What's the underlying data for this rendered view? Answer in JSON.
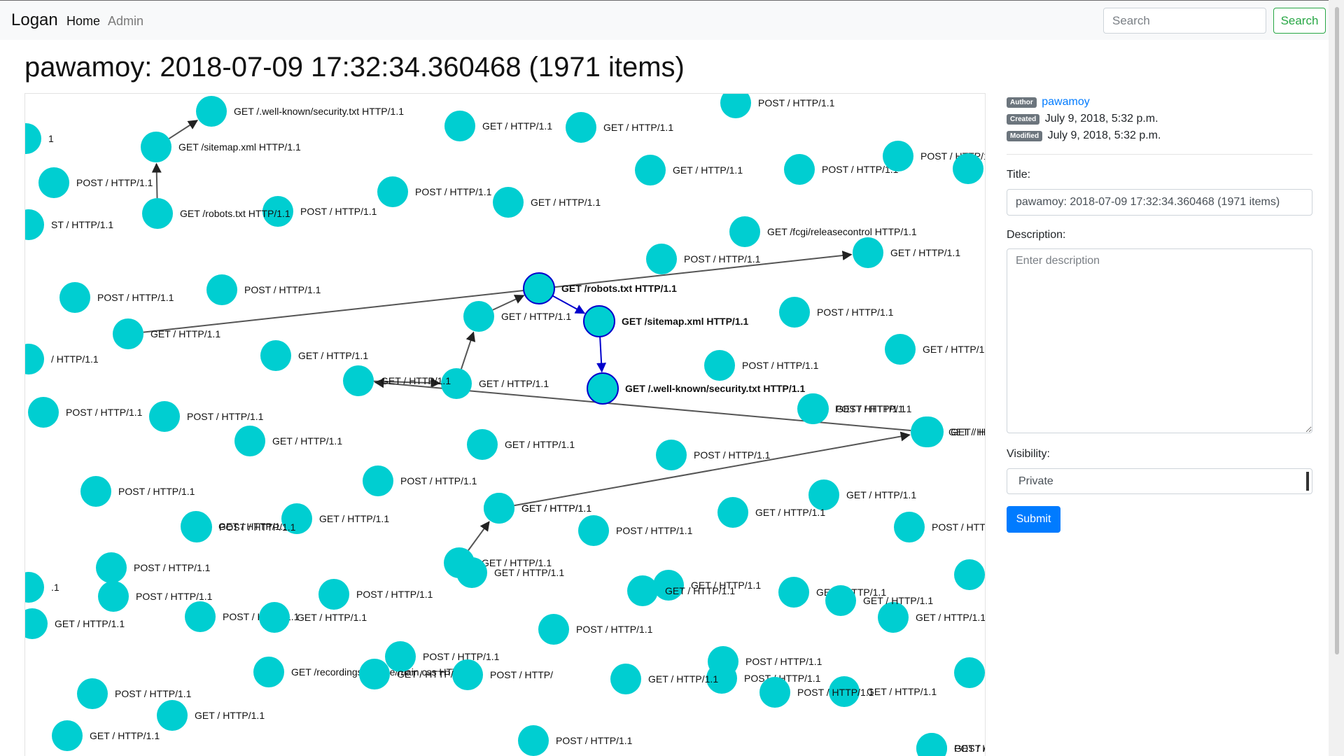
{
  "navbar": {
    "brand": "Logan",
    "links": [
      "Home",
      "Admin"
    ],
    "search_placeholder": "Search",
    "search_button": "Search"
  },
  "page": {
    "title": "pawamoy: 2018-07-09 17:32:34.360468 (1971 items)"
  },
  "sidebar": {
    "author_badge": "Author",
    "author": "pawamoy",
    "created_badge": "Created",
    "created": "July 9, 2018, 5:32 p.m.",
    "modified_badge": "Modified",
    "modified": "July 9, 2018, 5:32 p.m.",
    "title_label": "Title:",
    "title_value": "pawamoy: 2018-07-09 17:32:34.360468 (1971 items)",
    "description_label": "Description:",
    "description_placeholder": "Enter description",
    "visibility_label": "Visibility:",
    "visibility_value": "Private",
    "submit": "Submit"
  },
  "graph": {
    "node_color": "#00ced1",
    "selected_stroke": "#0000cc",
    "edge_color": "#555555",
    "nodes": [
      {
        "label": "GET /.well-known/security.txt HTTP/1.1"
      },
      {
        "label": "GET / HTTP/1.1"
      },
      {
        "label": "GET / HTTP/1.1"
      },
      {
        "label": "POST / HTTP/1.1"
      },
      {
        "label": "POST / HTTP/1.1"
      },
      {
        "label": "GET /sitemap.xml HTTP/1.1"
      },
      {
        "label": "GET / HTTP/1.1"
      },
      {
        "label": "POST / HTTP/1.1"
      },
      {
        "label": "POST / HTTP/1.1"
      },
      {
        "label": "POST / HTTP/1.1"
      },
      {
        "label": "GET / HTTP/1.1"
      },
      {
        "label": "GET /robots.txt HTTP/1.1"
      },
      {
        "label": "POST / HTTP/1.1"
      },
      {
        "label": "GET /fcgi/releasecontrol HTTP/1.1"
      },
      {
        "label": "POST / HTTP/1.1"
      },
      {
        "label": "GET / HTTP/1.1"
      },
      {
        "label": "POST / HTTP/1.1"
      },
      {
        "label": "GET / HTTP/1.1"
      },
      {
        "label": "POST / HTTP/1.1"
      },
      {
        "label": "GET /robots.txt HTTP/1.1",
        "selected": true
      },
      {
        "label": "GET / HTTP/1.1"
      },
      {
        "label": "GET /sitemap.xml HTTP/1.1",
        "selected": true
      },
      {
        "label": "POST / HTTP/1.1"
      },
      {
        "label": "GET / HTTP/1.1"
      },
      {
        "label": "GET / HTTP/1.1"
      },
      {
        "label": "POST / HTTP/1.1"
      },
      {
        "label": "GET / HTTP/1.1"
      },
      {
        "label": "GET / HTTP/1.1"
      },
      {
        "label": "GET /.well-known/security.txt HTTP/1.1",
        "selected": true
      },
      {
        "label": "GET / HTTP/1.1"
      },
      {
        "label": "POST / HTTP/1.1"
      },
      {
        "label": "POST / HTTP/1.1"
      },
      {
        "label": "GET / HTTP/1.1"
      },
      {
        "label": "POST / HTTP/1.1"
      },
      {
        "label": "GET / HTTP/1.1"
      },
      {
        "label": "GET / HTTP/1.1"
      },
      {
        "label": "GET / H"
      },
      {
        "label": "POST / HTTP/1.1"
      },
      {
        "label": "POST / HTTP/1.1"
      },
      {
        "label": "GET / HTTP/1.1"
      },
      {
        "label": "GET / HTTP/1.1"
      },
      {
        "label": "GET / HTTP/1.1"
      },
      {
        "label": "POST / HTTP/1.1"
      },
      {
        "label": "GET / HTTP/1.1"
      },
      {
        "label": "POST / HTT"
      },
      {
        "label": "GET / HTTP/1.1"
      },
      {
        "label": "GET / HTTP/1.1"
      },
      {
        "label": "POST / HTTP/1.1"
      },
      {
        "label": "GET / HTTP/1.1"
      },
      {
        "label": "POST / HTTP/1.1"
      },
      {
        "label": "POST / HTTP/1.1"
      },
      {
        "label": "GET / HTTP/1.1"
      },
      {
        "label": "GET / HTTP/1.1"
      },
      {
        "label": "POST / HTTP/1.1"
      },
      {
        "label": "GET / HTTP/1.1"
      },
      {
        "label": "GET / HTTP/1.1"
      },
      {
        "label": "POST / HTTP/1.1"
      },
      {
        "label": "GET / HTTP/1.1"
      },
      {
        "label": "POST / HTTP/1.1"
      },
      {
        "label": "GET /recordings//theme/main.css HTTP/1.1"
      },
      {
        "label": "POST / HTTP/1.1"
      },
      {
        "label": "GET / HTTP/1.1"
      },
      {
        "label": "GET / HTTP/1.1"
      },
      {
        "label": "POST / HTTP/1.1"
      },
      {
        "label": "POST / HTTP/1.1"
      },
      {
        "label": "GET / HTTP/1.1"
      },
      {
        "label": "POST / HTTP/1.1"
      },
      {
        "label": "POST / HTTP/1.1"
      },
      {
        "label": "POST / HTTP/1.1"
      },
      {
        "label": "POST /"
      },
      {
        "label": "POST / HTTP/"
      },
      {
        "label": "GET / HTTP/"
      },
      {
        "label": "GET / HTTP/1.1"
      },
      {
        "label": "POST / HTTP/1.1"
      },
      {
        "label": "GET / HTTP/1.1"
      },
      {
        "label": "POST / HTTP/1.1"
      },
      {
        "label": "GET / HTTP/1.1"
      },
      {
        "label": "GET / HTTP/1.1"
      },
      {
        "label": "POST / HTTP/1.1"
      },
      {
        "label": "1.1"
      },
      {
        "label": "ST / HTTP/1.1"
      },
      {
        "label": "/ HTTP/1.1"
      },
      {
        "label": "GET / HTTP/1.1"
      },
      {
        "label": ".1"
      },
      {
        "label": "1"
      }
    ],
    "edges": [
      {
        "from": 5,
        "to": 0
      },
      {
        "from": 11,
        "to": 5
      },
      {
        "from": 17,
        "to": 15
      },
      {
        "from": 27,
        "to": 26
      },
      {
        "from": 26,
        "to": 20
      },
      {
        "from": 20,
        "to": 19
      },
      {
        "from": 19,
        "to": 21,
        "selected": true
      },
      {
        "from": 21,
        "to": 28,
        "selected": true
      },
      {
        "from": 34,
        "to": 27
      },
      {
        "from": 41,
        "to": 34
      },
      {
        "from": 48,
        "to": 41
      }
    ]
  }
}
